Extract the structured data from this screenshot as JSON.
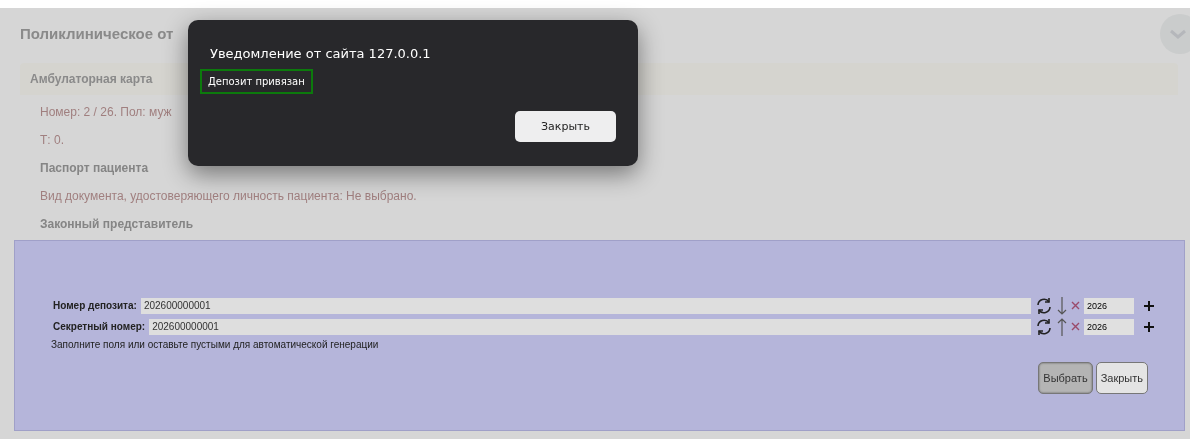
{
  "page": {
    "title": "Поликлиническое от",
    "card_title": "Амбулаторная карта",
    "lines": [
      {
        "kind": "info",
        "text": "Номер: 2 / 26. Пол: муж"
      },
      {
        "kind": "info",
        "text": "Т: 0."
      },
      {
        "kind": "heading",
        "text": "Паспорт пациента"
      },
      {
        "kind": "info",
        "text": "Вид документа, удостоверяющего личность пациента: Не выбрано."
      },
      {
        "kind": "heading",
        "text": "Законный представитель"
      }
    ]
  },
  "deposit_panel": {
    "rows": [
      {
        "label": "Номер депозита:",
        "value": "202600000001",
        "kind": "down",
        "year": "2026"
      },
      {
        "label": "Секретный номер:",
        "value": "202600000001",
        "kind": "up",
        "year": "2026"
      }
    ],
    "hint": "Заполните поля или оставьте пустыми для автоматической генерации",
    "buttons": [
      {
        "label": "Выбрать",
        "pressed": true
      },
      {
        "label": "Закрыть",
        "pressed": false
      }
    ]
  },
  "alert": {
    "title": "Уведомление от сайта 127.0.0.1",
    "message": "Депозит привязан",
    "button": "Закрыть"
  }
}
